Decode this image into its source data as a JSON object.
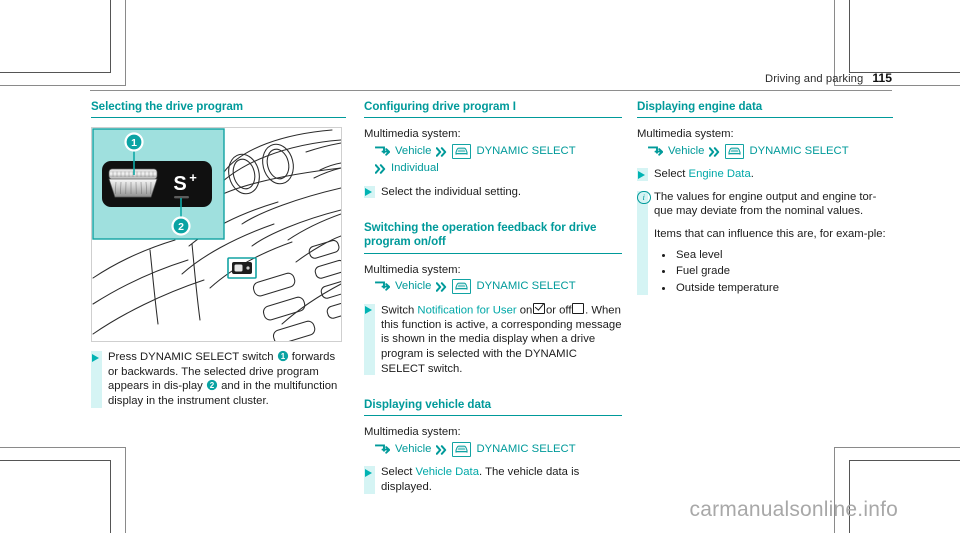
{
  "header": {
    "title": "Driving and parking",
    "page_number": "115"
  },
  "columns": {
    "left": {
      "heading": "Selecting the drive program",
      "figure": {
        "alt_name": "dynamic-select-switch-illustration",
        "callout_1": "1",
        "callout_2": "2",
        "switch_label": "S",
        "switch_label_sup": "+"
      },
      "instruction": {
        "line1_pre": "Press DYNAMIC SELECT switch",
        "callout": "1",
        "line1_post": "forwards or backwards.",
        "line2_pre": "The selected drive program appears in dis-play",
        "callout2": "2",
        "line2_post": "and in the multifunction display in the instrument cluster."
      }
    },
    "middle": {
      "section1": {
        "heading": "Configuring drive program I",
        "intro": "Multimedia system:",
        "path": {
          "item1": "Vehicle",
          "item2": "DYNAMIC SELECT",
          "item3": "Individual"
        },
        "step": "Select the individual setting."
      },
      "section2": {
        "heading": "Switching the operation feedback for drive program on/off",
        "intro": "Multimedia system:",
        "path": {
          "item1": "Vehicle",
          "item2": "DYNAMIC SELECT"
        },
        "step_pre": "Switch",
        "step_link": "Notification for User",
        "step_mid": "on",
        "step_mid2": "or off",
        "step_end": ".",
        "note": "When this function is active, a corresponding message is shown in the media display when a drive program is selected with the DYNAMIC SELECT switch."
      },
      "section3": {
        "heading": "Displaying vehicle data",
        "intro": "Multimedia system:",
        "path": {
          "item1": "Vehicle",
          "item2": "DYNAMIC SELECT"
        },
        "step_pre": "Select",
        "step_link": "Vehicle Data",
        "step_end": ".",
        "note": "The vehicle data is displayed."
      }
    },
    "right": {
      "section1": {
        "heading": "Displaying engine data",
        "intro": "Multimedia system:",
        "path": {
          "item1": "Vehicle",
          "item2": "DYNAMIC SELECT"
        },
        "step_pre": "Select",
        "step_link": "Engine Data",
        "step_end": ".",
        "info_note": "The values for engine output and engine tor-que may deviate from the nominal values.",
        "info_note2": "Items that can influence this are, for exam-ple:",
        "bullets": [
          "Sea level",
          "Fuel grade",
          "Outside temperature"
        ]
      }
    }
  },
  "watermark": "carmanualsonline.info",
  "colors": {
    "accent_teal": "#009a9a",
    "link_teal": "#00a8a8",
    "band_cyan": "#d5f4f4",
    "figure_panel": "#9fe0de"
  }
}
